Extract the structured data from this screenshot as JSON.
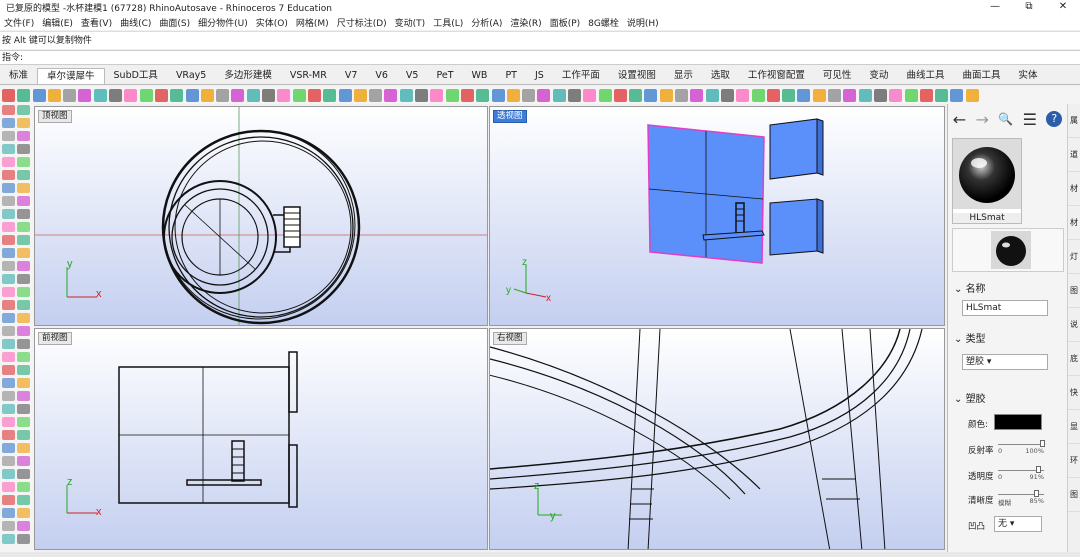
{
  "app": {
    "title": "已复原的模型 -水杯建模1 (67728) RhinoAutosave - Rhinoceros 7 Education",
    "window_controls": [
      "—",
      "⧉",
      "✕"
    ]
  },
  "menu": [
    "文件(F)",
    "编辑(E)",
    "查看(V)",
    "曲线(C)",
    "曲面(S)",
    "细分物件(U)",
    "实体(O)",
    "网格(M)",
    "尺寸标注(D)",
    "变动(T)",
    "工具(L)",
    "分析(A)",
    "渲染(R)",
    "面板(P)",
    "8G螺栓",
    "说明(H)"
  ],
  "command": {
    "history": "按 Alt 键可以复制物件",
    "prompt": "指令:"
  },
  "tabs": [
    "标准",
    "卓尔谟犀牛",
    "SubD工具",
    "VRay5",
    "多边形建模",
    "VSR-MR",
    "V7",
    "V6",
    "V5",
    "PeT",
    "WB",
    "PT",
    "JS",
    "工作平面",
    "设置视图",
    "显示",
    "选取",
    "工作视窗配置",
    "可见性",
    "变动",
    "曲线工具",
    "曲面工具",
    "实体"
  ],
  "viewports": {
    "top": {
      "label": "顶视图"
    },
    "perspective": {
      "label": "透视图"
    },
    "front": {
      "label": "前视图"
    },
    "right": {
      "label": "右视图"
    }
  },
  "axis": {
    "x": "x",
    "y": "y",
    "z": "z"
  },
  "panel": {
    "nav": [
      "←",
      "→",
      "🔍",
      "☰",
      "?"
    ],
    "material_name_thumb": "HLSmat",
    "name_section": "名称",
    "name_value": "HLSmat",
    "type_section": "类型",
    "type_value": "塑胶",
    "plastic_section": "塑胶",
    "color_label": "颜色:",
    "color_value": "#000000",
    "reflect_label": "反射率",
    "reflect_lo": "0",
    "reflect_hi": "100%",
    "reflect_level": 1.0,
    "transparency_label": "透明度",
    "trans_lo": "0",
    "trans_hi": "91%",
    "trans_level": 0.91,
    "clarity_label": "清晰度",
    "clarity_lo": "模糊",
    "clarity_hi": "85%",
    "clarity_level": 0.85,
    "bump_label": "凹凸",
    "bump_value": "无"
  },
  "right_tabs": [
    "属",
    "道",
    "材",
    "材",
    "灯",
    "图",
    "说",
    "底",
    "快",
    "显",
    "环",
    "图"
  ]
}
